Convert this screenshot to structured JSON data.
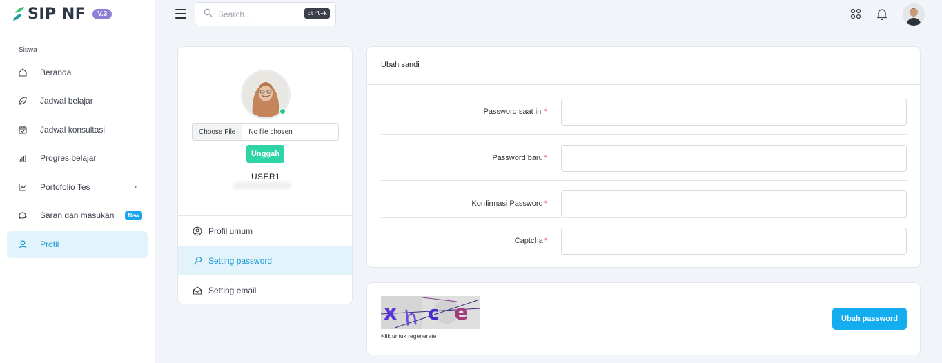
{
  "brand": {
    "name": "SIP NF",
    "version": "V.3",
    "accent": "#1a9bd7"
  },
  "sidebar": {
    "section": "Siswa",
    "items": [
      {
        "label": "Beranda",
        "icon": "home-icon"
      },
      {
        "label": "Jadwal belajar",
        "icon": "leaf-icon"
      },
      {
        "label": "Jadwal konsultasi",
        "icon": "calendar-icon"
      },
      {
        "label": "Progres belajar",
        "icon": "bar-chart-icon"
      },
      {
        "label": "Portofolio Tes",
        "icon": "line-chart-icon",
        "chevron": "›"
      },
      {
        "label": "Saran dan masukan",
        "icon": "chat-icon",
        "badge": "New"
      },
      {
        "label": "Profil",
        "icon": "user-icon",
        "active": true
      }
    ]
  },
  "topbar": {
    "search_placeholder": "Search...",
    "search_shortcut": "ctrl+k"
  },
  "profile": {
    "file_button": "Choose File",
    "file_status": "No file chosen",
    "upload_label": "Unggah",
    "username": "USER1",
    "menu": [
      {
        "label": "Profil umum",
        "icon": "user-circle-icon"
      },
      {
        "label": "Setting password",
        "icon": "key-icon",
        "active": true
      },
      {
        "label": "Setting email",
        "icon": "mail-open-icon"
      }
    ]
  },
  "password_form": {
    "title": "Ubah sandi",
    "fields": [
      {
        "label": "Password saat ini",
        "required": "*",
        "value": ""
      },
      {
        "label": "Password baru",
        "required": "*",
        "value": ""
      },
      {
        "label": "Konfirmasi Password",
        "required": "*",
        "value": ""
      },
      {
        "label": "Captcha",
        "required": "*",
        "value": ""
      }
    ]
  },
  "captcha": {
    "chars": [
      "x",
      "h",
      "c",
      "e"
    ],
    "hint": "Klik untuk regenerate",
    "submit_label": "Ubah password"
  }
}
